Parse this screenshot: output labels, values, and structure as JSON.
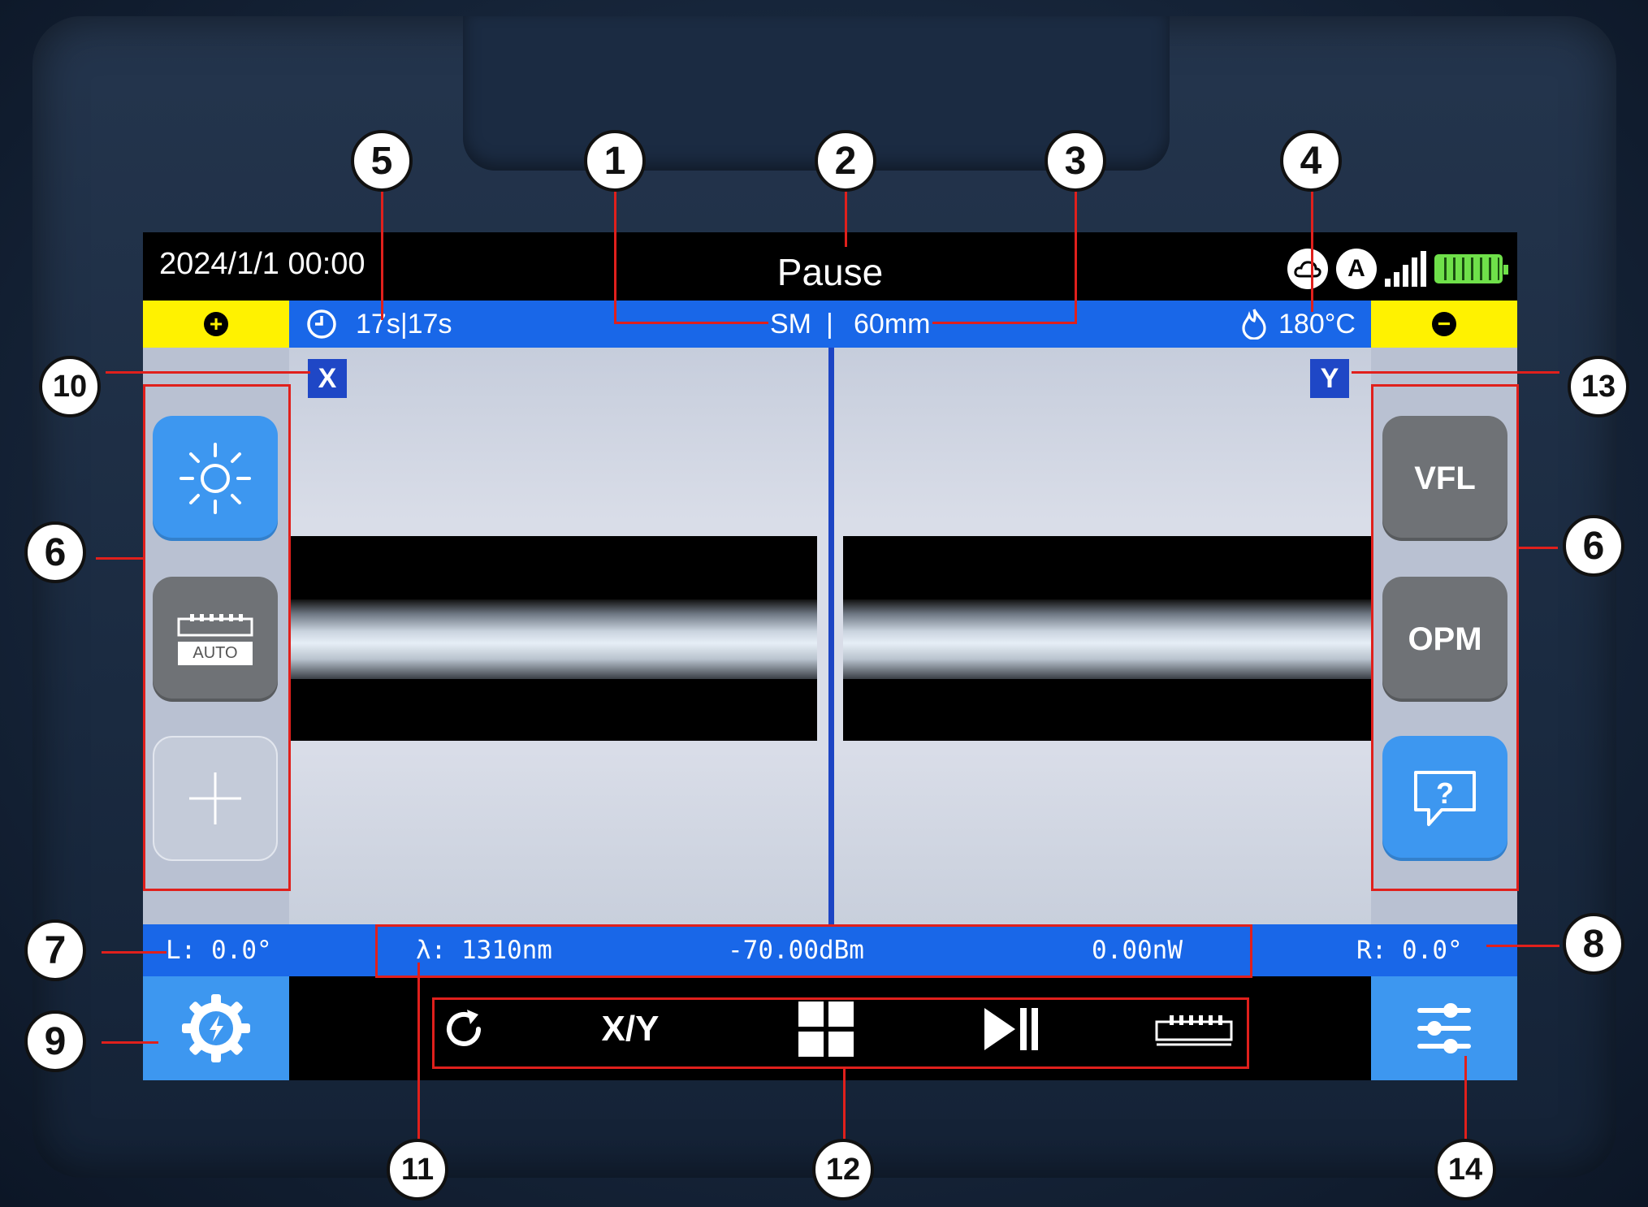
{
  "topbar": {
    "datetime": "2024/1/1  00:00",
    "status": "Pause"
  },
  "infobar": {
    "timer": "17s|17s",
    "mode": "SM",
    "separator": "|",
    "length": "60mm",
    "temperature": "180°C",
    "plus_icon": "+",
    "minus_icon": "−"
  },
  "viewport": {
    "left_axis": "X",
    "right_axis": "Y"
  },
  "left_panel": {
    "auto_label": "AUTO"
  },
  "right_panel": {
    "vfl_label": "VFL",
    "opm_label": "OPM"
  },
  "measure": {
    "left_angle": "L: 0.0°",
    "wavelength": "λ: 1310nm",
    "power_dbm": "-70.00dBm",
    "power_nw": "0.00nW",
    "right_angle": "R: 0.0°"
  },
  "toolbar": {
    "xy_label": "X/Y"
  },
  "annotations": [
    "1",
    "2",
    "3",
    "4",
    "5",
    "6",
    "6",
    "7",
    "8",
    "9",
    "10",
    "11",
    "12",
    "13",
    "14"
  ],
  "colors": {
    "accent_blue": "#1967e8",
    "button_blue": "#3d97f0",
    "yellow": "#fff200",
    "annotation_red": "#e0201c",
    "battery_green": "#6fe04a"
  }
}
